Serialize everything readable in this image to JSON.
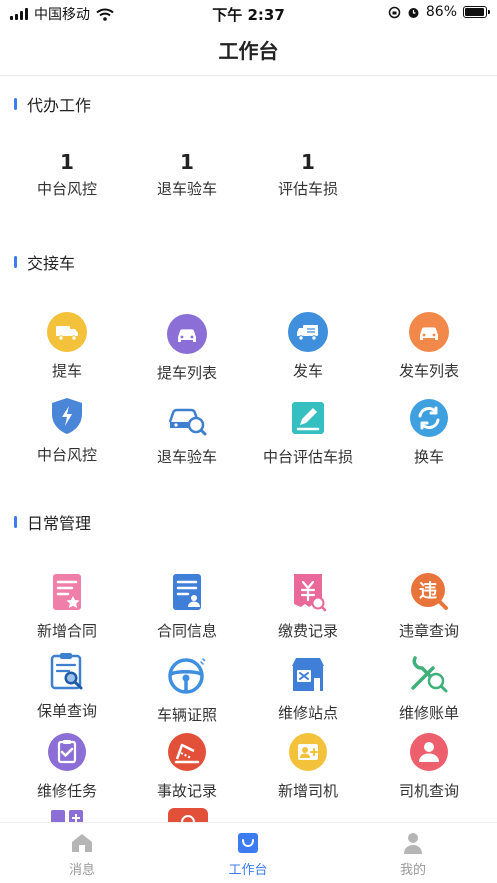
{
  "status_bar": {
    "carrier": "中国移动",
    "time": "下午 2:37",
    "battery": "86%",
    "battery_level": 0.86
  },
  "navbar": {
    "title": "工作台"
  },
  "todo": {
    "title": "代办工作",
    "items": [
      {
        "count": "1",
        "label": "中台风控"
      },
      {
        "count": "1",
        "label": "退车验车"
      },
      {
        "count": "1",
        "label": "评估车损"
      }
    ]
  },
  "handover": {
    "title": "交接车",
    "items": [
      {
        "label": "提车",
        "icon": "truck-icon",
        "color": "#f3c23a"
      },
      {
        "label": "提车列表",
        "icon": "car-icon",
        "color": "#8c6fd6"
      },
      {
        "label": "发车",
        "icon": "delivery-truck-icon",
        "color": "#3f8fdc"
      },
      {
        "label": "发车列表",
        "icon": "car-icon",
        "color": "#f2884a"
      },
      {
        "label": "中台风控",
        "icon": "shield-bolt-icon",
        "color": "#4a86d8"
      },
      {
        "label": "退车验车",
        "icon": "car-search-icon",
        "color": "#3f7fd0"
      },
      {
        "label": "中台评估车损",
        "icon": "edit-document-icon",
        "color": "#35bfc0"
      },
      {
        "label": "换车",
        "icon": "swap-icon",
        "color": "#3fa0e0"
      }
    ]
  },
  "daily": {
    "title": "日常管理",
    "items": [
      {
        "label": "新增合同",
        "icon": "contract-star-icon",
        "color": "#ef7fa8"
      },
      {
        "label": "合同信息",
        "icon": "contract-person-icon",
        "color": "#3f7fd8"
      },
      {
        "label": "缴费记录",
        "icon": "payment-icon",
        "color": "#e96a9a"
      },
      {
        "label": "违章查询",
        "icon": "violation-icon",
        "color": "#e8743b"
      },
      {
        "label": "保单查询",
        "icon": "clipboard-search-icon",
        "color": "#3f7fd0"
      },
      {
        "label": "车辆证照",
        "icon": "steering-wheel-icon",
        "color": "#3f8fe0"
      },
      {
        "label": "维修站点",
        "icon": "repair-shop-icon",
        "color": "#3f7fd8"
      },
      {
        "label": "维修账单",
        "icon": "wrench-search-icon",
        "color": "#3fb07a"
      },
      {
        "label": "维修任务",
        "icon": "task-icon",
        "color": "#8c6fd6"
      },
      {
        "label": "事故记录",
        "icon": "accident-icon",
        "color": "#e2503a"
      },
      {
        "label": "新增司机",
        "icon": "add-driver-icon",
        "color": "#f3c23a"
      },
      {
        "label": "司机查询",
        "icon": "driver-search-icon",
        "color": "#ee5f6e"
      }
    ]
  },
  "tabbar": {
    "tabs": [
      {
        "label": "消息"
      },
      {
        "label": "工作台"
      },
      {
        "label": "我的"
      }
    ]
  }
}
